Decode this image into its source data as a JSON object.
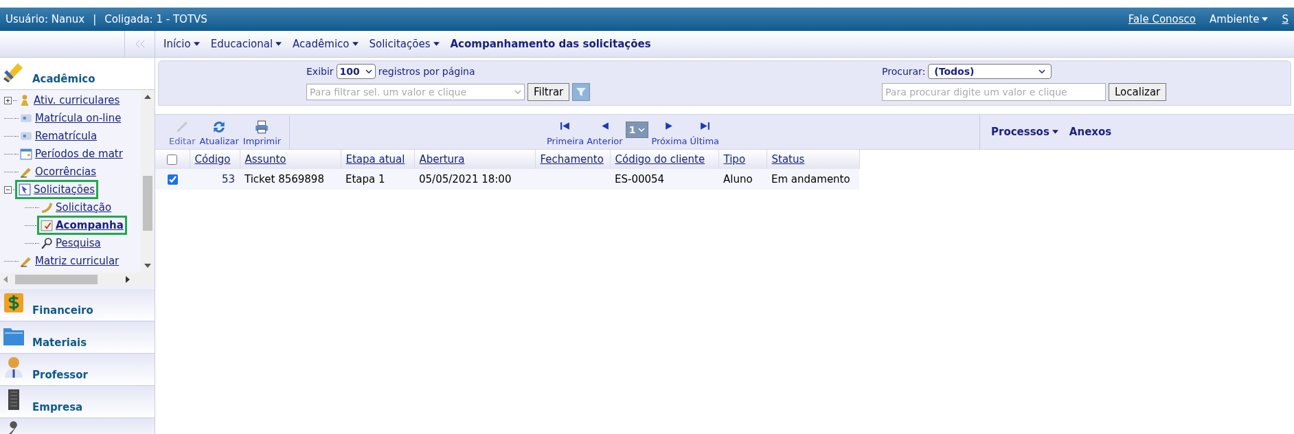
{
  "header": {
    "user": "Usuário: Nanux",
    "separator": "|",
    "company": "Coligada: 1 - TOTVS",
    "links": [
      {
        "label": "Fale Conosco",
        "kind": "link"
      },
      {
        "label": "Ambiente",
        "kind": "menu"
      },
      {
        "label": "S",
        "kind": "link"
      }
    ]
  },
  "breadcrumb": [
    {
      "label": "Início",
      "kind": "menu"
    },
    {
      "label": "Educacional",
      "kind": "menu"
    },
    {
      "label": "Acadêmico",
      "kind": "menu"
    },
    {
      "label": "Solicitações",
      "kind": "menu"
    },
    {
      "label": "Acompanhamento das solicitações",
      "kind": "current"
    }
  ],
  "sidebar": {
    "modules": [
      {
        "label": "Acadêmico",
        "selected": true
      },
      {
        "label": "Financeiro",
        "selected": false
      },
      {
        "label": "Materiais",
        "selected": false
      },
      {
        "label": "Professor",
        "selected": false
      },
      {
        "label": "Empresa",
        "selected": false
      }
    ],
    "tree": [
      {
        "label": "Ativ. curriculares",
        "expanded": false,
        "highlighted": false,
        "selected": false
      },
      {
        "label": "Matrícula on-line",
        "highlighted": false,
        "selected": false
      },
      {
        "label": "Rematrícula",
        "highlighted": false,
        "selected": false
      },
      {
        "label": "Períodos de matr",
        "highlighted": false,
        "selected": false
      },
      {
        "label": "Ocorrências",
        "highlighted": false,
        "selected": false
      },
      {
        "label": "Solicitações",
        "expanded": true,
        "highlighted": true,
        "selected": false,
        "children": [
          {
            "label": "Solicitação",
            "highlighted": false,
            "selected": false
          },
          {
            "label": "Acompanha",
            "highlighted": true,
            "selected": true
          },
          {
            "label": "Pesquisa",
            "highlighted": false,
            "selected": false
          }
        ]
      },
      {
        "label": "Matriz curricular",
        "highlighted": false,
        "selected": false
      }
    ]
  },
  "filter": {
    "show_label": "Exibir",
    "page_size": "100",
    "per_page_label": "registros por página",
    "filter_placeholder": "Para filtrar sel. um valor e clique",
    "filter_button": "Filtrar",
    "search_label": "Procurar:",
    "search_field": "(Todos)",
    "search_placeholder": "Para procurar digite um valor e clique",
    "search_button": "Localizar"
  },
  "toolbar": {
    "actions": [
      {
        "label": "Editar",
        "disabled": true
      },
      {
        "label": "Atualizar",
        "disabled": false
      },
      {
        "label": "Imprimir",
        "disabled": false
      }
    ],
    "pager": [
      {
        "label": "Primeira"
      },
      {
        "label": "Anterior"
      },
      {
        "label": "Próxima"
      },
      {
        "label": "Última"
      }
    ],
    "page": "1",
    "menus": [
      {
        "label": "Processos",
        "kind": "menu"
      },
      {
        "label": "Anexos",
        "kind": "plain"
      }
    ]
  },
  "table": {
    "all_checked": false,
    "columns": [
      "Código",
      "Assunto",
      "Etapa atual",
      "Abertura",
      "Fechamento",
      "Código do cliente",
      "Tipo",
      "Status"
    ],
    "rows": [
      {
        "checked": true,
        "cells": [
          "53",
          "Ticket 8569898",
          "Etapa 1",
          "05/05/2021 18:00",
          "",
          "ES-00054",
          "Aluno",
          "Em andamento"
        ]
      }
    ]
  }
}
